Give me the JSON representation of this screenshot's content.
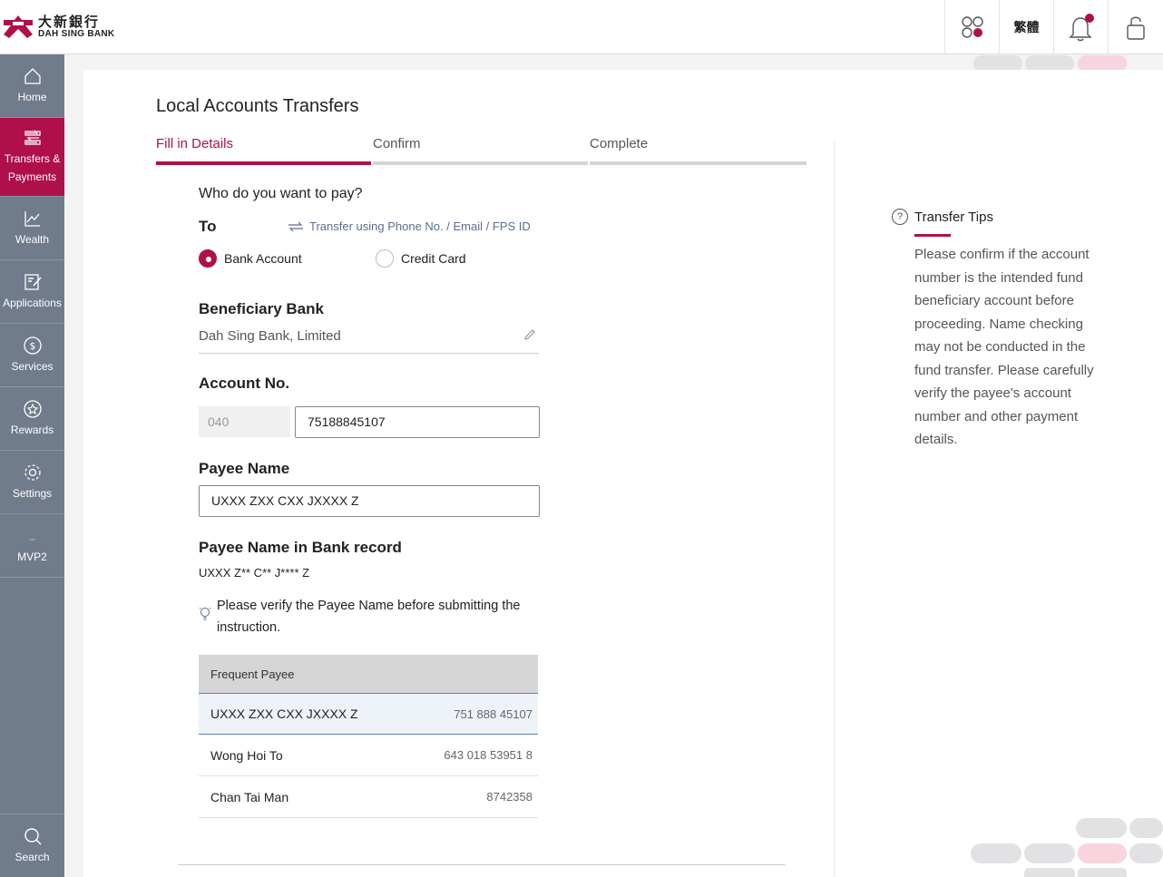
{
  "header": {
    "logo_cn": "大新銀行",
    "logo_en": "DAH SING BANK",
    "language_label": "繁體",
    "colors": {
      "brand": "#b0104a",
      "sidebar": "#707b8c"
    }
  },
  "sidebar": {
    "items": [
      {
        "label": "Home",
        "icon": "home-icon"
      },
      {
        "label": "Transfers & Payments",
        "icon": "transfer-icon"
      },
      {
        "label": "Wealth",
        "icon": "chart-icon"
      },
      {
        "label": "Applications",
        "icon": "edit-form-icon"
      },
      {
        "label": "Services",
        "icon": "dollar-icon"
      },
      {
        "label": "Rewards",
        "icon": "star-icon"
      },
      {
        "label": "Settings",
        "icon": "gear-icon"
      },
      {
        "label": "MVP2",
        "icon": "dash-icon"
      },
      {
        "label": "Search",
        "icon": "search-icon"
      }
    ]
  },
  "page": {
    "title": "Local Accounts Transfers",
    "steps": [
      "Fill in Details",
      "Confirm",
      "Complete"
    ]
  },
  "form": {
    "question": "Who do you want to pay?",
    "to_label": "To",
    "fps_link": "Transfer using Phone No. / Email / FPS ID",
    "radio_bank": "Bank Account",
    "radio_credit": "Credit Card",
    "beneficiary_label": "Beneficiary Bank",
    "beneficiary_value": "Dah Sing Bank, Limited",
    "account_label": "Account No.",
    "account_prefix": "040",
    "account_value": "75188845107",
    "payee_label": "Payee Name",
    "payee_value": "UXXX ZXX CXX JXXXX Z",
    "record_label": "Payee Name in Bank record",
    "record_value": "UXXX Z** C** J**** Z",
    "verify_note": "Please verify the Payee Name before submitting the instruction."
  },
  "frequent_payee": {
    "header": "Frequent Payee",
    "rows": [
      {
        "name": "UXXX ZXX CXX JXXXX Z",
        "number": "751 888 45107"
      },
      {
        "name": "Wong Hoi To",
        "number": "643 018 53951 8"
      },
      {
        "name": "Chan Tai Man",
        "number": "8742358"
      }
    ]
  },
  "tips": {
    "title": "Transfer Tips",
    "body": "Please confirm if the account number is the intended fund beneficiary account before proceeding. Name checking may not be conducted in the fund transfer. Please carefully verify the payee's account number and other payment details."
  }
}
